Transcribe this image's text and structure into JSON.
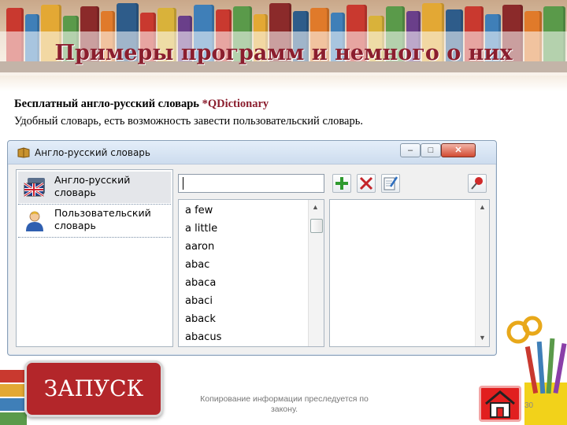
{
  "slide": {
    "title": "Примеры программ и немного о них",
    "line1_a": "Бесплатный англо-русский словарь ",
    "line1_b": "*QDictionary",
    "line2": "Удобный словарь, есть возможность завести пользовательский словарь."
  },
  "window": {
    "title": "Англо-русский словарь",
    "min_glyph": "–",
    "max_glyph": "□",
    "close_glyph": "✕",
    "dictionaries": [
      {
        "label": "Англо-русский словарь",
        "icon": "uk-flag-book-icon"
      },
      {
        "label": "Пользовательский словарь",
        "icon": "user-icon"
      }
    ],
    "search_value": "",
    "toolbar": {
      "add_icon": "plus-icon",
      "delete_icon": "delete-icon",
      "edit_icon": "edit-icon",
      "pin_icon": "pin-icon"
    },
    "words": [
      "a few",
      "a little",
      "aaron",
      "abac",
      "abaca",
      "abaci",
      "aback",
      "abacus"
    ]
  },
  "footer": {
    "launch_label": "ЗАПУСК",
    "copyright": "Копирование информации преследуется по закону.",
    "page_number": "30"
  },
  "colors": {
    "title": "#8b1e2e",
    "launch": "#b3262a",
    "home": "#e11f1f"
  }
}
